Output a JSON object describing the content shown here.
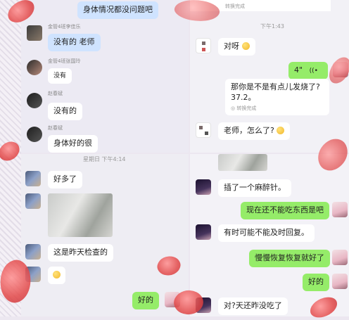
{
  "top_left": {
    "top_message": "身体情况都没问题吧",
    "messages": [
      {
        "name": "金管4班李佳乐",
        "text": "没有的 老师"
      },
      {
        "name": "金管4班张国玲",
        "text": "没有"
      },
      {
        "name": "赵春斌",
        "text": "没有的"
      },
      {
        "name": "赵春斌",
        "text": "身体好的很"
      }
    ]
  },
  "top_right": {
    "top_subtext": "转换完成",
    "timestamp": "下午1:43",
    "msg1": "对呀",
    "voice_duration": "4\"",
    "msg2_line1": "那你是不是有点儿发烧了?",
    "msg2_line2": "37.2。",
    "msg2_sub": "转换完成",
    "msg3": "老师，怎么了?"
  },
  "bottom_left": {
    "timestamp": "星期日 下午4:14",
    "msg1": "好多了",
    "msg2": "这是昨天检查的",
    "msg3": "好的"
  },
  "bottom_right": {
    "msg1": "插了一个麻醉针。",
    "msg2": "现在还不能吃东西是吧",
    "msg3": "有时可能不能及时回复。",
    "msg4": "慢慢恢复恢复就好了",
    "msg5": "好的",
    "msg6": "对?天还昨没吃了"
  },
  "colors": {
    "sent_bubble": "#95ec69",
    "received_bubble": "#ffffff",
    "panel_bg": "#eceaf3"
  }
}
